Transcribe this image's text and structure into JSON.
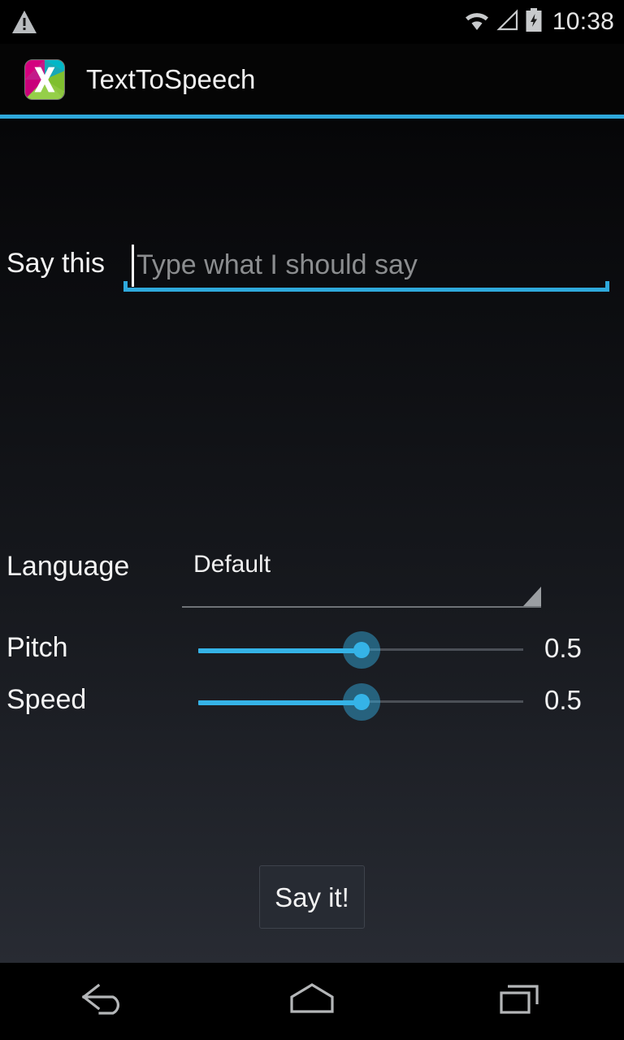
{
  "status_bar": {
    "warning_icon": "warning-triangle-icon",
    "wifi_icon": "wifi-icon",
    "signal_icon": "cell-signal-icon",
    "battery_icon": "battery-charging-icon",
    "clock": "10:38"
  },
  "action_bar": {
    "app_icon": "app-launcher-icon",
    "title": "TextToSpeech",
    "divider_color": "#2fa9dc"
  },
  "form": {
    "say_this_label": "Say this",
    "say_this_value": "",
    "say_this_placeholder": "Type what I should say",
    "language_label": "Language",
    "language_value": "Default",
    "language_options": [
      "Default"
    ],
    "pitch_label": "Pitch",
    "pitch_value": "0.5",
    "speed_label": "Speed",
    "speed_value": "0.5",
    "say_it_label": "Say it!",
    "accent_color": "#35b3e7"
  },
  "nav_bar": {
    "back": "back-icon",
    "home": "home-icon",
    "recents": "recent-apps-icon"
  }
}
